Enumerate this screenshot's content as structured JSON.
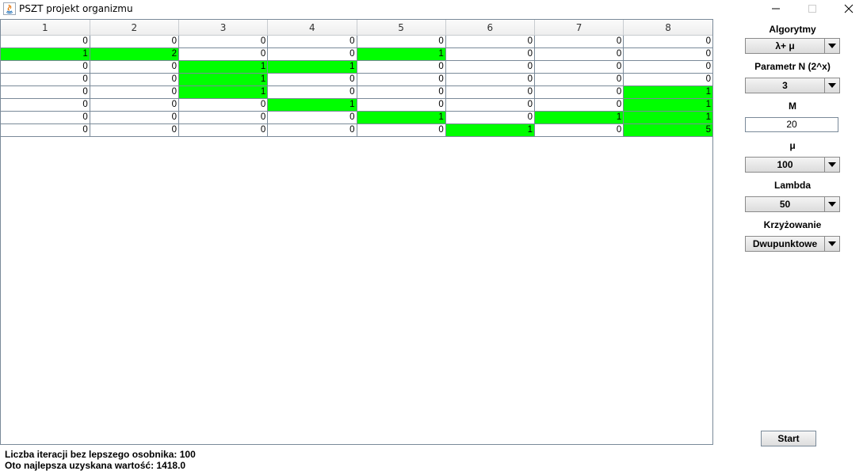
{
  "window": {
    "title": "PSZT projekt organizmu",
    "controls": [
      "minimize-icon",
      "maximize-icon",
      "close-icon"
    ]
  },
  "table": {
    "columns": [
      "1",
      "2",
      "3",
      "4",
      "5",
      "6",
      "7",
      "8"
    ],
    "rows": [
      [
        0,
        0,
        0,
        0,
        0,
        0,
        0,
        0
      ],
      [
        1,
        2,
        0,
        0,
        1,
        0,
        0,
        0
      ],
      [
        0,
        0,
        1,
        1,
        0,
        0,
        0,
        0
      ],
      [
        0,
        0,
        1,
        0,
        0,
        0,
        0,
        0
      ],
      [
        0,
        0,
        1,
        0,
        0,
        0,
        0,
        1
      ],
      [
        0,
        0,
        0,
        1,
        0,
        0,
        0,
        1
      ],
      [
        0,
        0,
        0,
        0,
        1,
        0,
        1,
        1
      ],
      [
        0,
        0,
        0,
        0,
        0,
        1,
        0,
        5
      ]
    ],
    "highlighted": [
      [
        false,
        false,
        false,
        false,
        false,
        false,
        false,
        false
      ],
      [
        true,
        true,
        false,
        false,
        true,
        false,
        false,
        false
      ],
      [
        false,
        false,
        true,
        true,
        false,
        false,
        false,
        false
      ],
      [
        false,
        false,
        true,
        false,
        false,
        false,
        false,
        false
      ],
      [
        false,
        false,
        true,
        false,
        false,
        false,
        false,
        true
      ],
      [
        false,
        false,
        false,
        true,
        false,
        false,
        false,
        true
      ],
      [
        false,
        false,
        false,
        false,
        true,
        false,
        true,
        true
      ],
      [
        false,
        false,
        false,
        false,
        false,
        true,
        false,
        true
      ]
    ],
    "highlight_color": "#00ff00"
  },
  "panel": {
    "algorytmy_label": "Algorytmy",
    "algorytmy_value": "λ+ μ",
    "parametr_n_label": "Parametr N (2^x)",
    "parametr_n_value": "3",
    "m_label": "M",
    "m_value": "20",
    "mu_label": "μ",
    "mu_value": "100",
    "lambda_label": "Lambda",
    "lambda_value": "50",
    "krzyzowanie_label": "Krzyżowanie",
    "krzyzowanie_value": "Dwupunktowe",
    "start_label": "Start"
  },
  "status": {
    "iterations": "Liczba iteracji bez lepszego osobnika: 100",
    "best_value": "Oto najlepsza uzyskana wartość: 1418.0"
  }
}
